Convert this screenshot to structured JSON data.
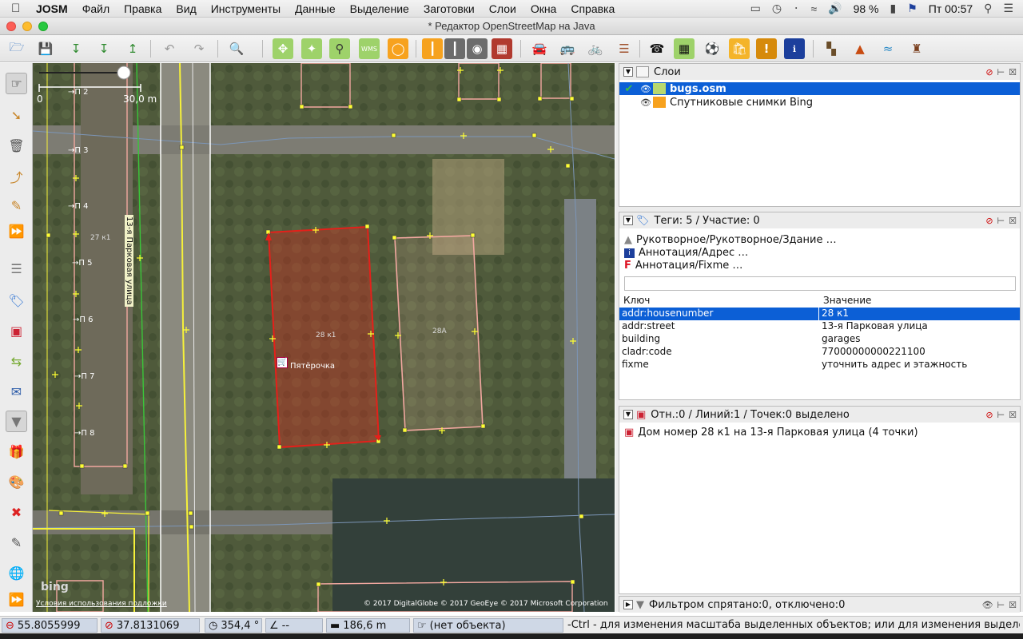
{
  "menubar": {
    "app_name": "JOSM",
    "items": [
      "Файл",
      "Правка",
      "Вид",
      "Инструменты",
      "Данные",
      "Выделение",
      "Заготовки",
      "Слои",
      "Окна",
      "Справка"
    ],
    "battery": "98 %",
    "clock": "Пт 00:57"
  },
  "window": {
    "title": "* Редактор OpenStreetMap на Java"
  },
  "map": {
    "scale_left": "0",
    "scale_right": "30,0 m",
    "street_label": "13-я Парковая улица",
    "labels": [
      "→П 2",
      "→П 3",
      "→П 4",
      "27 к1",
      "→П 5",
      "→П 6",
      "→П 7",
      "→П 8"
    ],
    "building_selected_label": "28 к1",
    "building_other_label": "28А",
    "shop_label": "Пятёрочка",
    "bing": "bing",
    "terms": "Условия использования подложки",
    "copyright": "© 2017 DigitalGlobe © 2017 GeoEye © 2017 Microsoft Corporation"
  },
  "layers_panel": {
    "title": "Слои",
    "items": [
      {
        "name": "bugs.osm",
        "active": true
      },
      {
        "name": "Спутниковые снимки Bing",
        "active": false
      }
    ]
  },
  "tags_panel": {
    "title": "Теги: 5 / Участие: 0",
    "presets": [
      "Рукотворное/Рукотворное/Здание …",
      "Аннотация/Адрес …",
      "Аннотация/Fixme …"
    ],
    "col_key": "Ключ",
    "col_value": "Значение",
    "rows": [
      {
        "key": "addr:housenumber",
        "value": "28 к1"
      },
      {
        "key": "addr:street",
        "value": "13-я Парковая улица"
      },
      {
        "key": "building",
        "value": "garages"
      },
      {
        "key": "cladr:code",
        "value": "77000000000221100"
      },
      {
        "key": "fixme",
        "value": "уточнить адрес и этажность"
      }
    ]
  },
  "selection_panel": {
    "title": "Отн.:0 / Линий:1 / Точек:0 выделено",
    "items": [
      "Дом номер 28 к1 на 13-я Парковая улица (4 точки)"
    ]
  },
  "filter_panel": {
    "title": "Фильтром спрятано:0, отключено:0"
  },
  "statusbar": {
    "lat": "55.8055999",
    "lon": "37.8131069",
    "heading": "354,4 °",
    "angle": "--",
    "distance": "186,6 m",
    "object": "(нет объекта)",
    "hint": "-Ctrl - для изменения масштаба выделенных объектов; или для изменения выделения"
  },
  "colors": {
    "selection": "#0c5fd6",
    "selected_way": "#e5201a",
    "building_outline": "#f2a8a0",
    "node": "#ffff33"
  }
}
